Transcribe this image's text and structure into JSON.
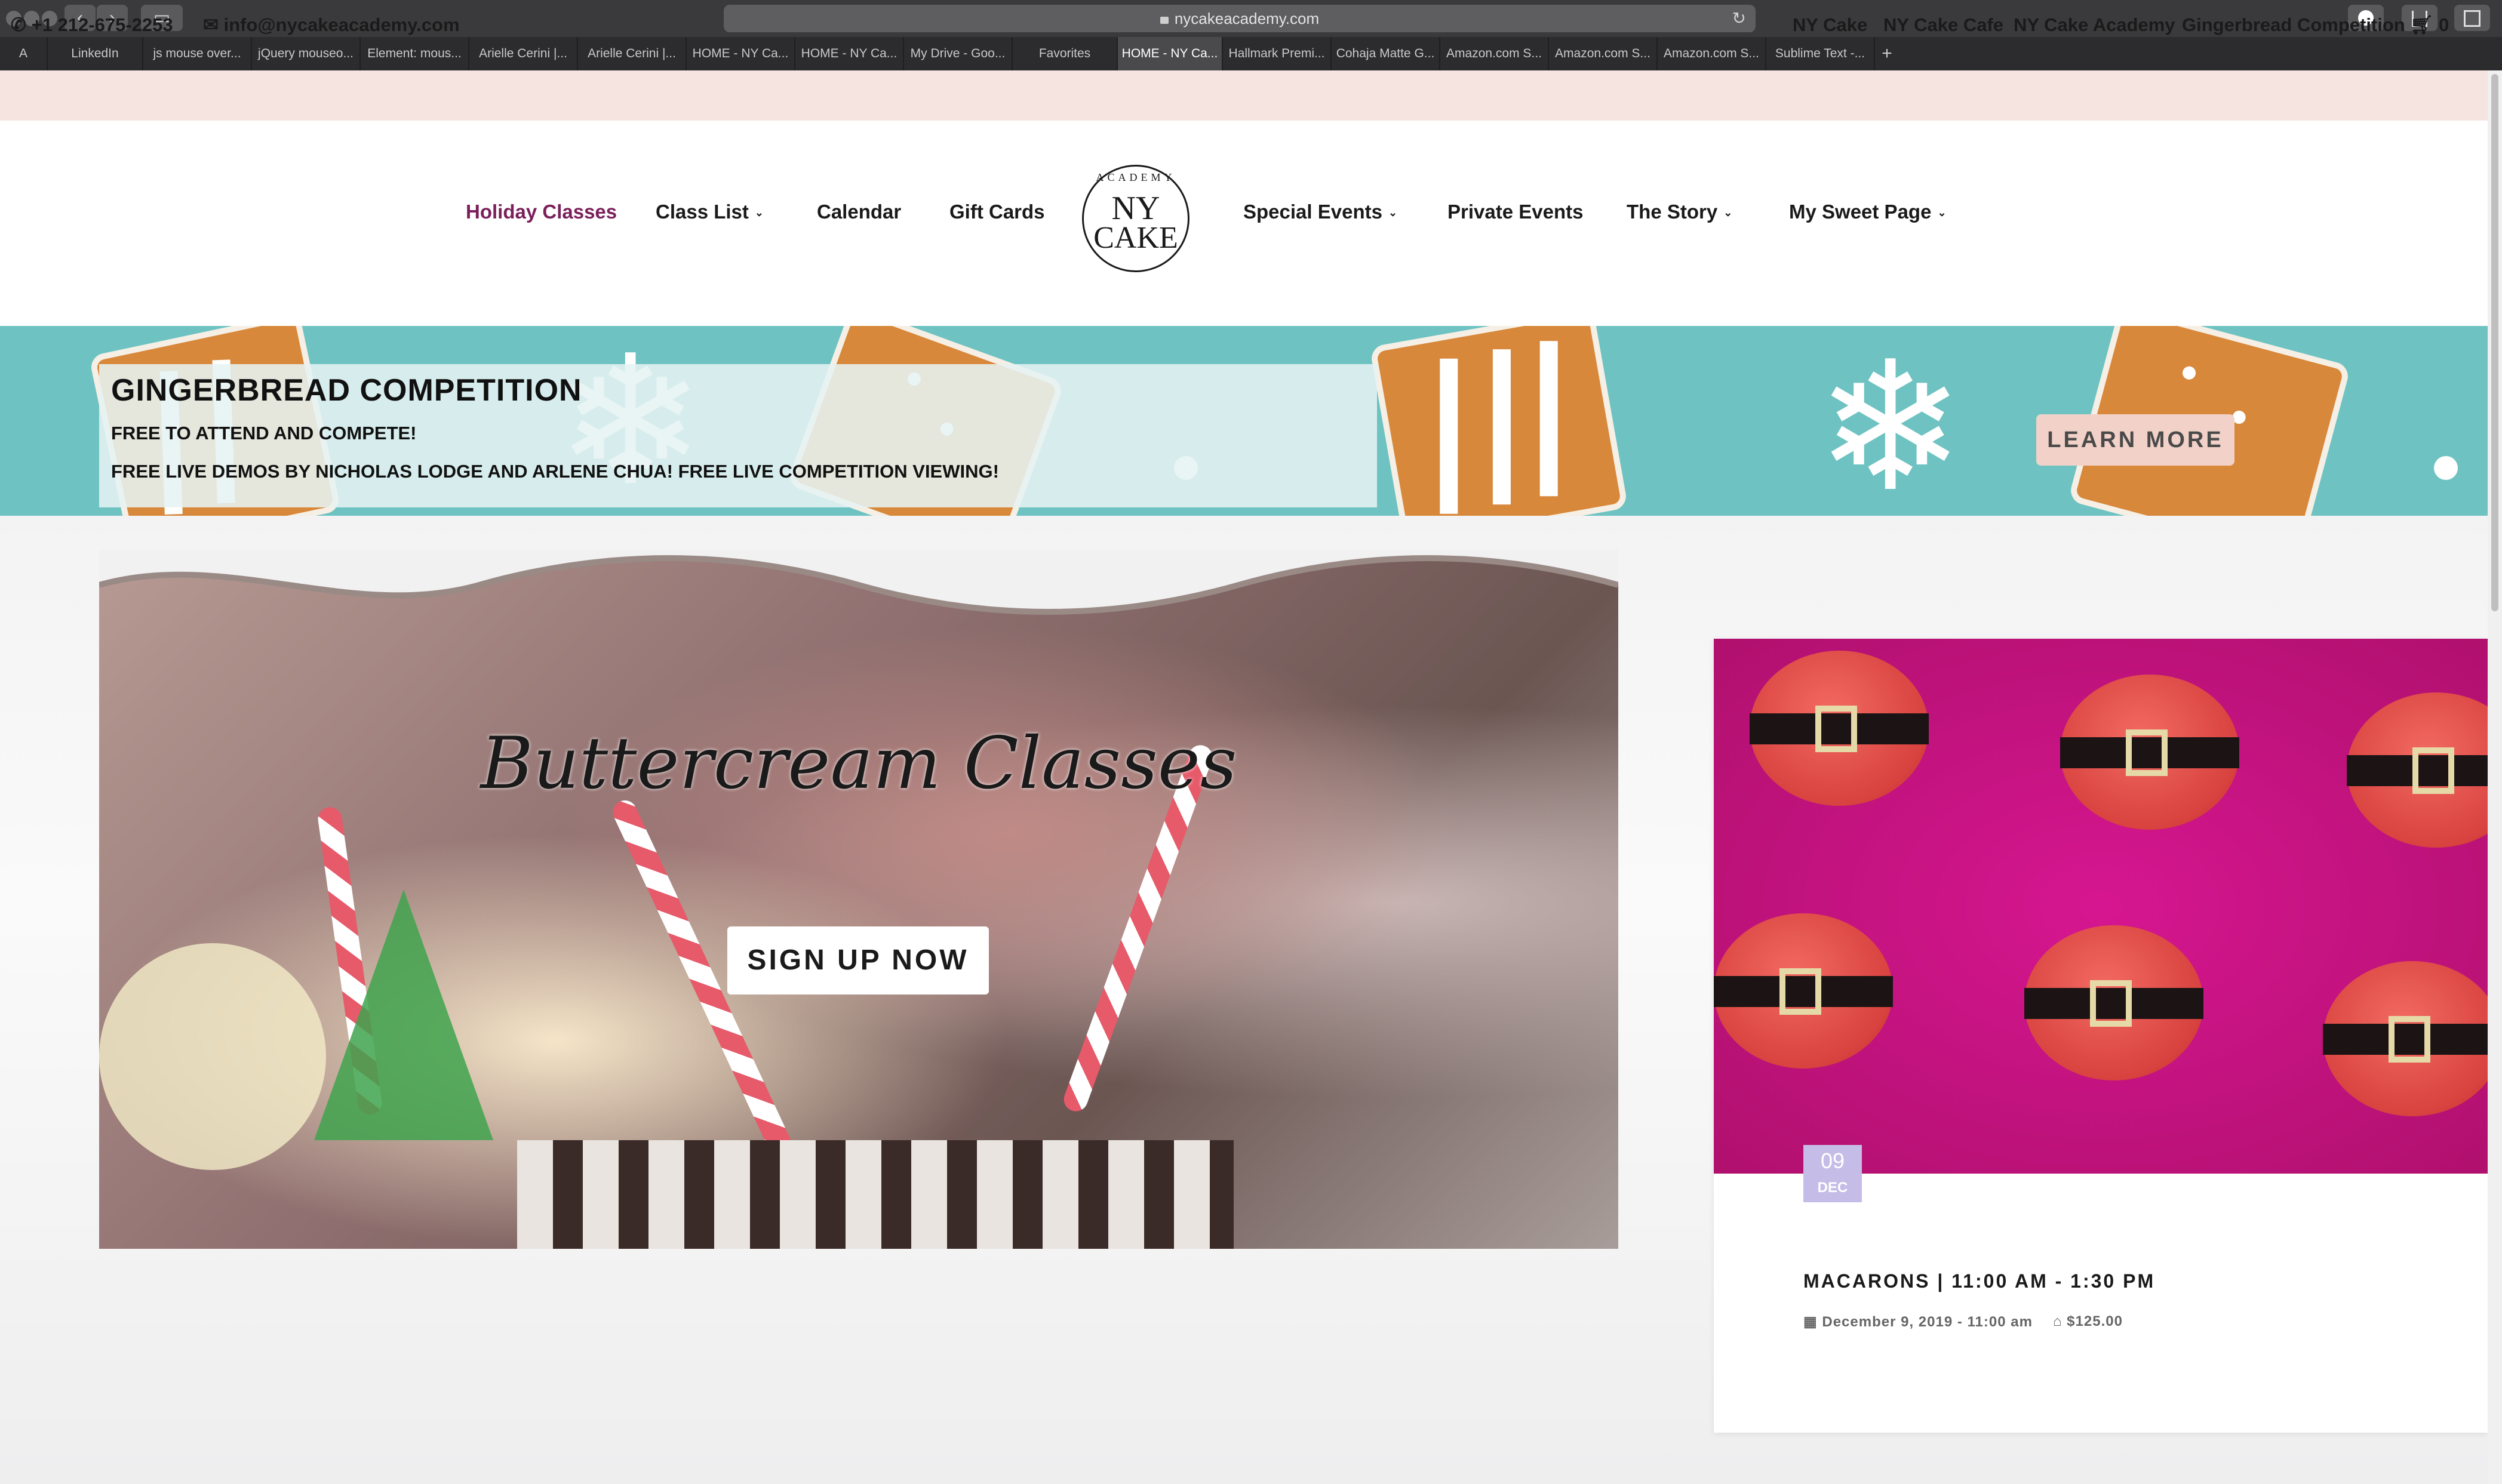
{
  "browser": {
    "url": "nycakeacademy.com",
    "tabs": [
      "A",
      "LinkedIn",
      "js mouse over...",
      "jQuery mouseo...",
      "Element: mous...",
      "Arielle Cerini |...",
      "Arielle Cerini |...",
      "HOME - NY Ca...",
      "HOME - NY Ca...",
      "My Drive - Goo...",
      "Favorites",
      "HOME - NY Ca...",
      "Hallmark Premi...",
      "Cohaja Matte G...",
      "Amazon.com S...",
      "Amazon.com S...",
      "Amazon.com S...",
      "Sublime Text -..."
    ],
    "active_tab_index": 11,
    "add_tab": "+"
  },
  "topbar": {
    "phone": "+1 212-675-2253",
    "email": "info@nycakeacademy.com",
    "links": [
      "NY Cake",
      "NY Cake Cafe",
      "NY Cake Academy",
      "Gingerbread Competition"
    ],
    "cart_count": "0"
  },
  "nav": {
    "left": [
      "Holiday Classes",
      "Class List",
      "Calendar",
      "Gift Cards"
    ],
    "right": [
      "Special Events",
      "Private Events",
      "The Story",
      "My Sweet Page"
    ],
    "logo": {
      "academy": "ACADEMY",
      "ny": "NY",
      "cake": "CAKE"
    }
  },
  "banner": {
    "title": "GINGERBREAD COMPETITION",
    "line1": "FREE TO ATTEND AND COMPETE!",
    "line2": "FREE LIVE DEMOS BY NICHOLAS LODGE AND ARLENE CHUA! FREE LIVE COMPETITION VIEWING!",
    "cta": "LEARN MORE"
  },
  "hero": {
    "title": "Buttercream Classes",
    "cta": "SIGN UP NOW"
  },
  "event": {
    "day": "09",
    "month": "DEC",
    "title": "MACARONS | 11:00 AM - 1:30 PM",
    "date": "December 9, 2019 - 11:00 am",
    "price": "$125.00"
  },
  "colors": {
    "topbar_bg": "#f6e4e1",
    "nav_active": "#7a1f5a",
    "banner_bg": "#6ec3c2",
    "learn_more_bg": "#f2d2c8",
    "date_badge": "#c5bde8"
  }
}
